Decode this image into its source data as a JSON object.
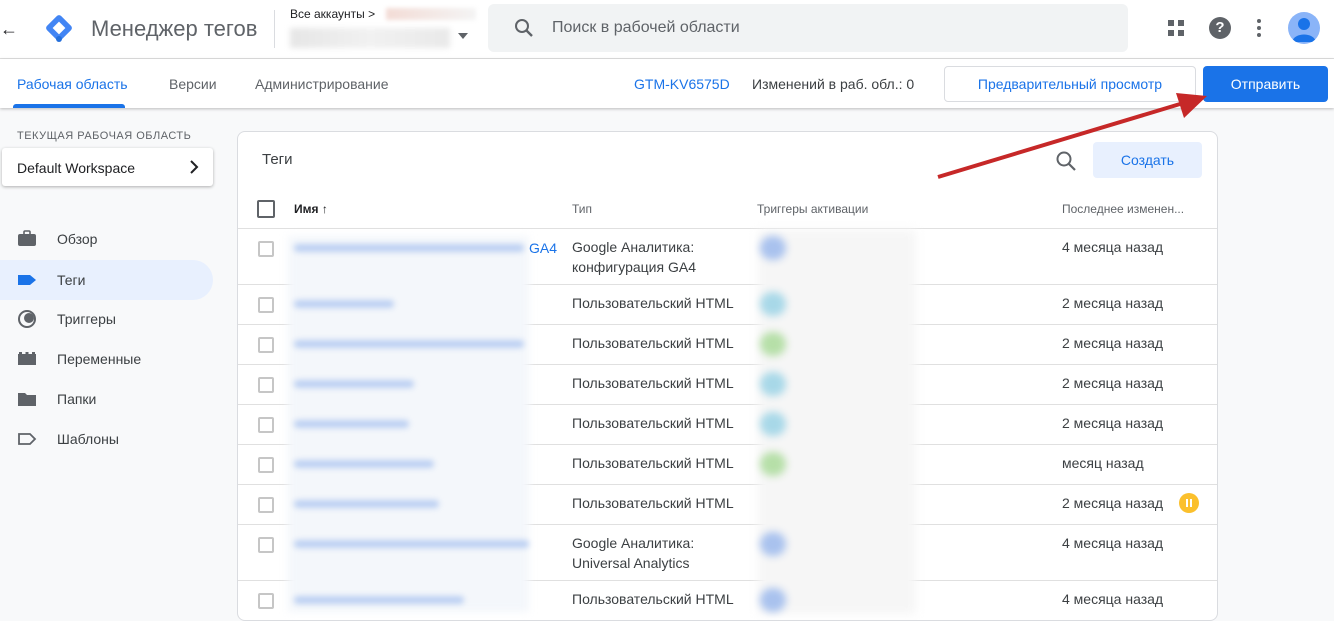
{
  "header": {
    "app_title": "Менеджер тегов",
    "accounts_label": "Все аккаунты >",
    "search_placeholder": "Поиск в рабочей области"
  },
  "subnav": {
    "tabs": [
      {
        "label": "Рабочая область",
        "active": true
      },
      {
        "label": "Версии",
        "active": false
      },
      {
        "label": "Администрирование",
        "active": false
      }
    ],
    "container_id": "GTM-KV6575D",
    "changes_label": "Изменений в раб. обл.: 0",
    "preview_label": "Предварительный просмотр",
    "submit_label": "Отправить"
  },
  "sidebar": {
    "section_label": "ТЕКУЩАЯ РАБОЧАЯ ОБЛАСТЬ",
    "workspace_name": "Default Workspace",
    "items": [
      {
        "label": "Обзор",
        "icon": "briefcase-icon",
        "active": false
      },
      {
        "label": "Теги",
        "icon": "tag-icon",
        "active": true
      },
      {
        "label": "Триггеры",
        "icon": "trigger-icon",
        "active": false
      },
      {
        "label": "Переменные",
        "icon": "variables-icon",
        "active": false
      },
      {
        "label": "Папки",
        "icon": "folder-icon",
        "active": false
      },
      {
        "label": "Шаблоны",
        "icon": "template-icon",
        "active": false
      }
    ]
  },
  "tags_card": {
    "title": "Теги",
    "create_label": "Создать",
    "columns": {
      "name": "Имя",
      "type": "Тип",
      "triggers": "Триггеры активации",
      "modified": "Последнее изменен..."
    },
    "first_name_suffix": "GA4",
    "rows": [
      {
        "type_line1": "Google Аналитика:",
        "type_line2": "конфигурация GA4",
        "modified": "4 месяца назад",
        "paused": false
      },
      {
        "type_line1": "Пользовательский HTML",
        "type_line2": "",
        "modified": "2 месяца назад",
        "paused": false
      },
      {
        "type_line1": "Пользовательский HTML",
        "type_line2": "",
        "modified": "2 месяца назад",
        "paused": false
      },
      {
        "type_line1": "Пользовательский HTML",
        "type_line2": "",
        "modified": "2 месяца назад",
        "paused": false
      },
      {
        "type_line1": "Пользовательский HTML",
        "type_line2": "",
        "modified": "2 месяца назад",
        "paused": false
      },
      {
        "type_line1": "Пользовательский HTML",
        "type_line2": "",
        "modified": "месяц назад",
        "paused": false
      },
      {
        "type_line1": "Пользовательский HTML",
        "type_line2": "",
        "modified": "2 месяца назад",
        "paused": true
      },
      {
        "type_line1": "Google Аналитика:",
        "type_line2": "Universal Analytics",
        "modified": "4 месяца назад",
        "paused": false
      },
      {
        "type_line1": "Пользовательский HTML",
        "type_line2": "",
        "modified": "4 месяца назад",
        "paused": false
      }
    ]
  },
  "colors": {
    "accent": "#1a73e8",
    "annotation_arrow": "#c62828",
    "paused_badge": "#fbc02d"
  }
}
